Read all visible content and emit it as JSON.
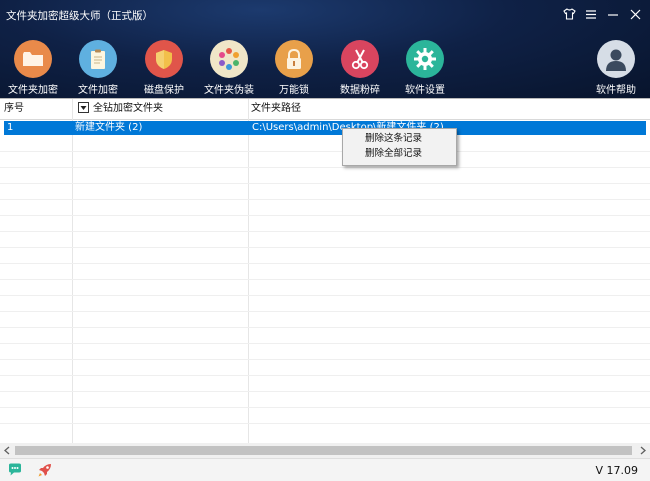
{
  "window": {
    "title": "文件夹加密超级大师（正式版）"
  },
  "toolbar": {
    "items": [
      {
        "label": "文件夹加密",
        "icon": "folder-icon",
        "color": "#e98a4a"
      },
      {
        "label": "文件加密",
        "icon": "document-icon",
        "color": "#5fb0e0"
      },
      {
        "label": "磁盘保护",
        "icon": "shield-icon",
        "color": "#e0554a"
      },
      {
        "label": "文件夹伪装",
        "icon": "palette-icon",
        "color": "#f0e6c8"
      },
      {
        "label": "万能锁",
        "icon": "lock-icon",
        "color": "#e8a04a"
      },
      {
        "label": "数据粉碎",
        "icon": "scissors-icon",
        "color": "#d9455f"
      },
      {
        "label": "软件设置",
        "icon": "gear-icon",
        "color": "#2bb59a"
      }
    ],
    "help": {
      "label": "软件帮助",
      "icon": "user-icon",
      "color": "#d6dde6"
    }
  },
  "table": {
    "columns": [
      "序号",
      "全钻加密文件夹",
      "文件夹路径"
    ],
    "rows": [
      {
        "index": "1",
        "name": "新建文件夹 (2)",
        "path": "C:\\Users\\admin\\Desktop\\新建文件夹 (2)"
      }
    ]
  },
  "context_menu": {
    "items": [
      "删除这条记录",
      "删除全部记录"
    ]
  },
  "status": {
    "version": "V 17.09"
  }
}
